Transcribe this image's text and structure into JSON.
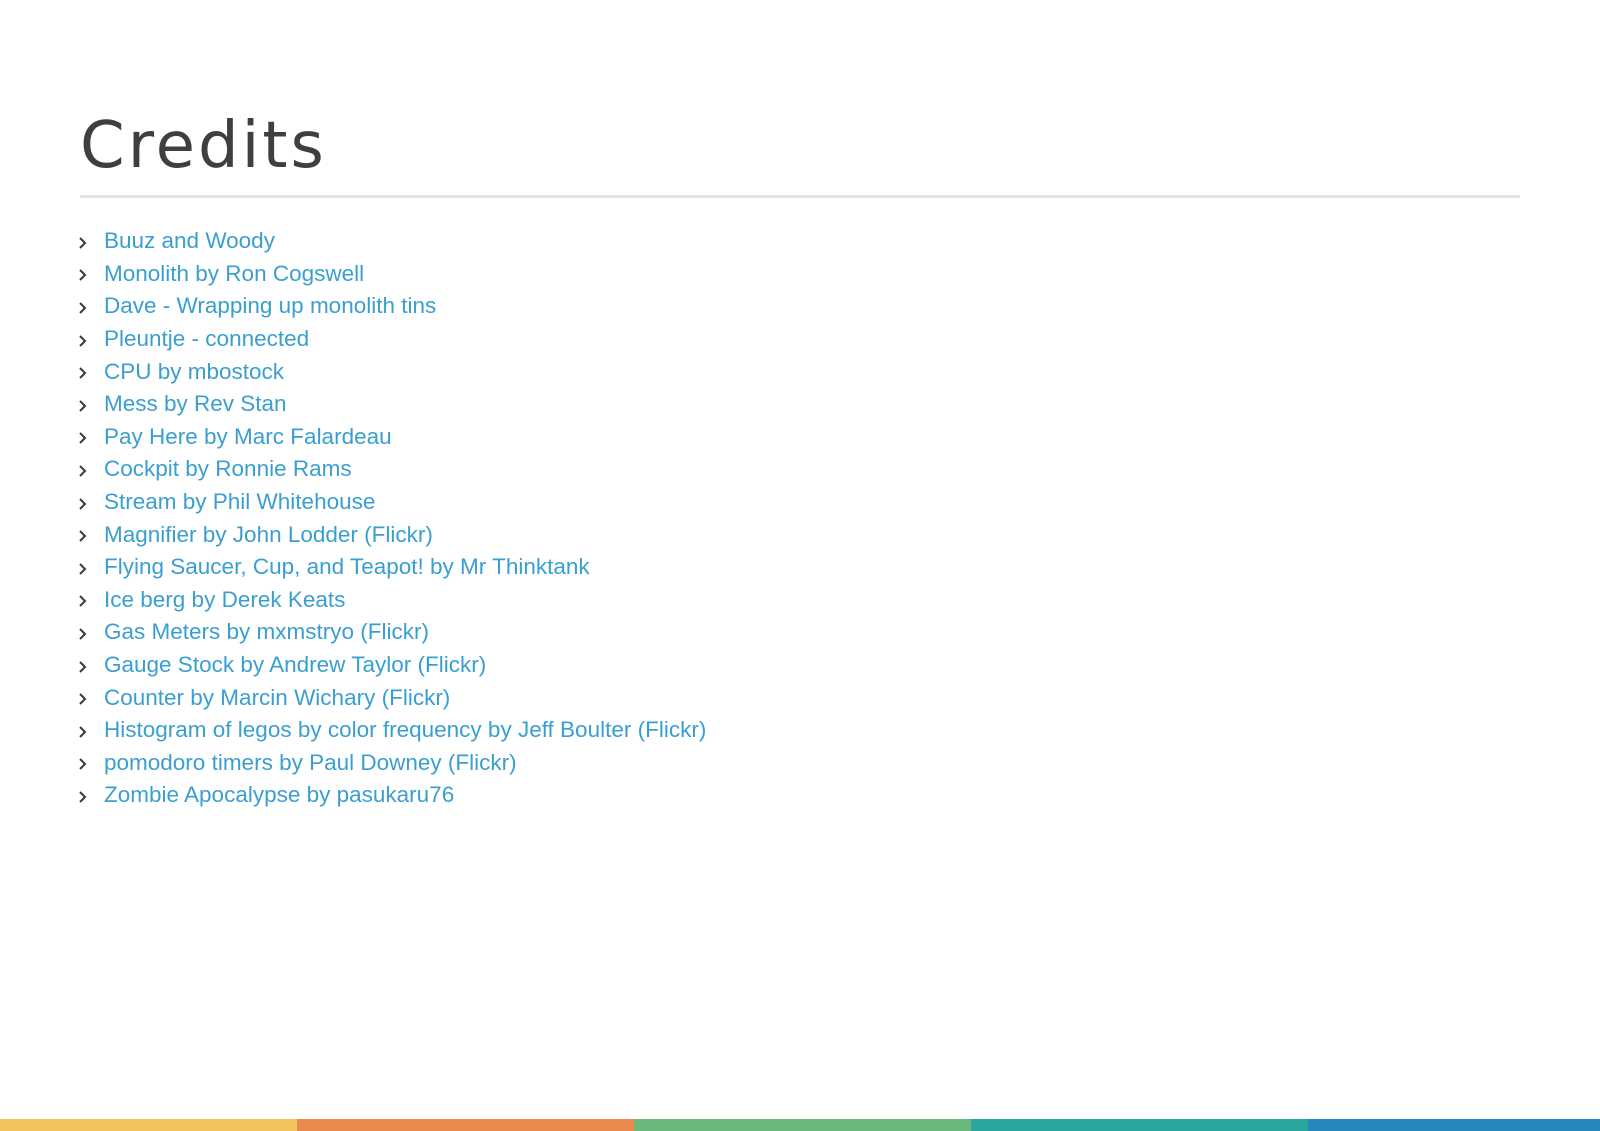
{
  "page": {
    "title": "Credits"
  },
  "credits": [
    "Buuz and Woody",
    "Monolith by Ron Cogswell",
    "Dave - Wrapping up monolith tins",
    "Pleuntje - connected",
    "CPU by mbostock",
    "Mess by Rev Stan",
    "Pay Here by Marc Falardeau",
    "Cockpit by Ronnie Rams",
    "Stream by Phil Whitehouse",
    "Magnifier by John Lodder (Flickr)",
    "Flying Saucer, Cup, and Teapot! by Mr Thinktank",
    "Ice berg by Derek Keats",
    "Gas Meters by mxmstryo (Flickr)",
    "Gauge Stock by Andrew Taylor (Flickr)",
    "Counter by Marcin Wichary (Flickr)",
    "Histogram of legos by color frequency by Jeff Boulter (Flickr)",
    "pomodoro timers by Paul Downey (Flickr)",
    "Zombie Apocalypse by pasukaru76"
  ],
  "icons": {
    "bullet": "chevron-right-icon"
  },
  "colors": {
    "title": "#3f3f3f",
    "link": "#3a9fd0",
    "rule": "#e4e4e4",
    "footer_bar": [
      "#f2c35a",
      "#eb8a4f",
      "#6ab97a",
      "#2aa69f",
      "#2688bd"
    ]
  }
}
